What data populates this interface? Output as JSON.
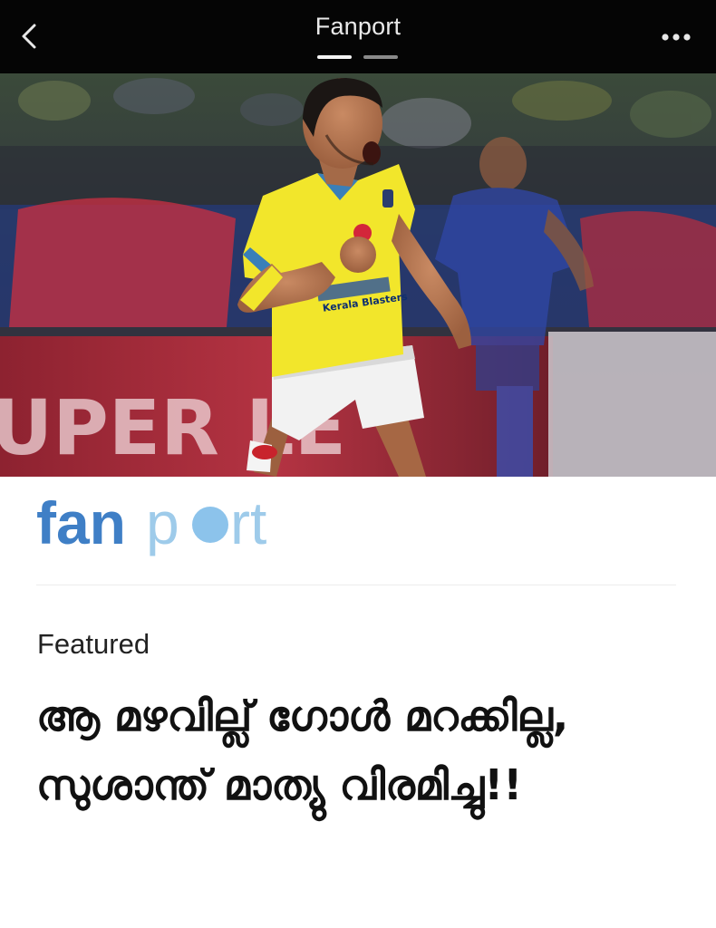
{
  "header": {
    "title": "Fanport",
    "back_icon": "chevron-left-icon",
    "more_icon": "more-horizontal-icon",
    "pages": 2,
    "active_page": 1
  },
  "hero": {
    "jersey_text": "Kerala Blasters",
    "banner_text": "UPER LE"
  },
  "brand": {
    "logo_text_dark": "fan",
    "logo_text_light_1": "p",
    "logo_text_light_2": "rt",
    "logo_colors": {
      "fan": "#3f7fc6",
      "port": "#9ecbea",
      "dot": "#8cc3eb"
    }
  },
  "article": {
    "category": "Featured",
    "headline": "ആ മഴവില്ല് ഗോൾ മറക്കില്ല, സുശാന്ത് മാത്യു വിരമിച്ചു!!"
  },
  "colors": {
    "topbar": "#050505",
    "title": "#e9e9e9",
    "jersey": "#f2e62b",
    "jersey_blue": "#3047a8"
  }
}
